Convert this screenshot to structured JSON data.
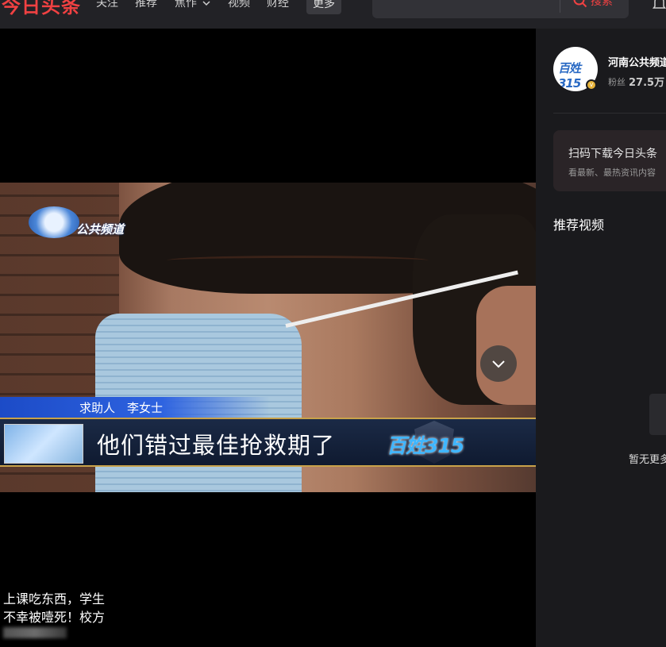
{
  "header": {
    "logo": "今日头条",
    "nav": [
      "关注",
      "推荐",
      "焦作",
      "视频",
      "财经"
    ],
    "more": "更多",
    "search_button": "搜索"
  },
  "video": {
    "channel_name": "公共频道",
    "person_label": "求助人　李女士",
    "caption": "他们错过最佳抢救期了",
    "show_logo_text": "百姓315"
  },
  "related": {
    "title_line1": "上课吃东西，学生",
    "title_line2": "不幸被噎死！校方"
  },
  "author": {
    "name": "河南公共频道",
    "fans_label": "粉丝",
    "fans_count": "27.5万"
  },
  "download": {
    "title": "扫码下载今日头条",
    "subtitle": "看最新、最热资讯内容"
  },
  "recommend": {
    "title": "推荐视频",
    "empty_text": "暂无更多"
  }
}
